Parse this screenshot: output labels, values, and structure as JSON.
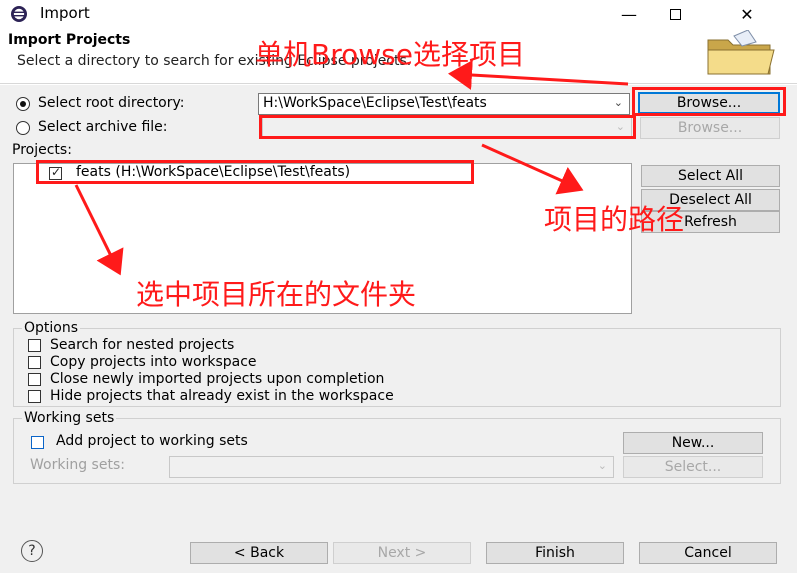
{
  "window": {
    "title": "Import",
    "minimize_icon": "minimize-icon",
    "maximize_icon": "maximize-icon",
    "close_icon": "close-icon"
  },
  "header": {
    "title": "Import Projects",
    "subtitle": "Select a directory to search for existing Eclipse projects.",
    "icon": "folder-icon"
  },
  "source": {
    "root_label": "Select root directory:",
    "root_value": "H:\\WorkSpace\\Eclipse\\Test\\feats",
    "browse_label": "Browse...",
    "archive_label": "Select archive file:",
    "archive_value": "",
    "archive_browse_label": "Browse..."
  },
  "projects": {
    "label": "Projects:",
    "items": [
      {
        "label": "feats (H:\\WorkSpace\\Eclipse\\Test\\feats)",
        "checked": true
      }
    ],
    "select_all_label": "Select All",
    "deselect_all_label": "Deselect All",
    "refresh_label": "Refresh"
  },
  "options": {
    "title": "Options",
    "items": [
      "Search for nested projects",
      "Copy projects into workspace",
      "Close newly imported projects upon completion",
      "Hide projects that already exist in the workspace"
    ]
  },
  "working_sets": {
    "title": "Working sets",
    "add_label": "Add project to working sets",
    "new_label": "New...",
    "sets_label": "Working sets:",
    "sets_value": "",
    "select_label": "Select..."
  },
  "footer": {
    "help_label": "?",
    "back_label": "< Back",
    "next_label": "Next >",
    "finish_label": "Finish",
    "cancel_label": "Cancel"
  },
  "annotations": {
    "browse_note": "单机Browse选择项目",
    "path_note": "项目的路径",
    "folder_note": "选中项目所在的文件夹",
    "color": "#ff1a1a"
  }
}
